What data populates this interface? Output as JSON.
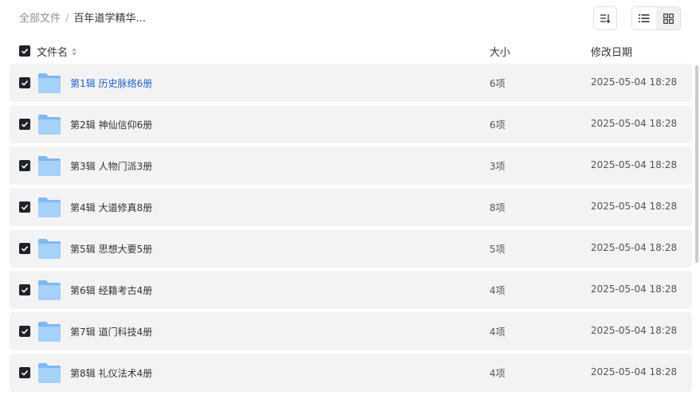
{
  "breadcrumb": {
    "root": "全部文件",
    "separator": "/",
    "current": "百年道学精华..."
  },
  "toolbar": {
    "sort_icon": "sort-icon",
    "list_view_icon": "list-view-icon",
    "grid_view_icon": "grid-view-icon",
    "active_view": "list"
  },
  "columns": {
    "name": "文件名",
    "size": "大小",
    "date": "修改日期"
  },
  "rows": [
    {
      "name": "第1辑 历史脉络6册",
      "size": "6项",
      "date": "2025-05-04 18:28",
      "checked": true
    },
    {
      "name": "第2辑 神仙信仰6册",
      "size": "6项",
      "date": "2025-05-04 18:28",
      "checked": true
    },
    {
      "name": "第3辑 人物门派3册",
      "size": "3项",
      "date": "2025-05-04 18:28",
      "checked": true
    },
    {
      "name": "第4辑 大道修真8册",
      "size": "8项",
      "date": "2025-05-04 18:28",
      "checked": true
    },
    {
      "name": "第5辑 思想大要5册",
      "size": "5项",
      "date": "2025-05-04 18:28",
      "checked": true
    },
    {
      "name": "第6辑 经籍考古4册",
      "size": "4项",
      "date": "2025-05-04 18:28",
      "checked": true
    },
    {
      "name": "第7辑 道门科技4册",
      "size": "4项",
      "date": "2025-05-04 18:28",
      "checked": true
    },
    {
      "name": "第8辑 礼仪法术4册",
      "size": "4项",
      "date": "2025-05-04 18:28",
      "checked": true
    }
  ],
  "colors": {
    "link": "#2064c9",
    "row_bg": "#f3f3f4",
    "checkbox": "#1f2329",
    "folder": "#8cc4f3"
  }
}
